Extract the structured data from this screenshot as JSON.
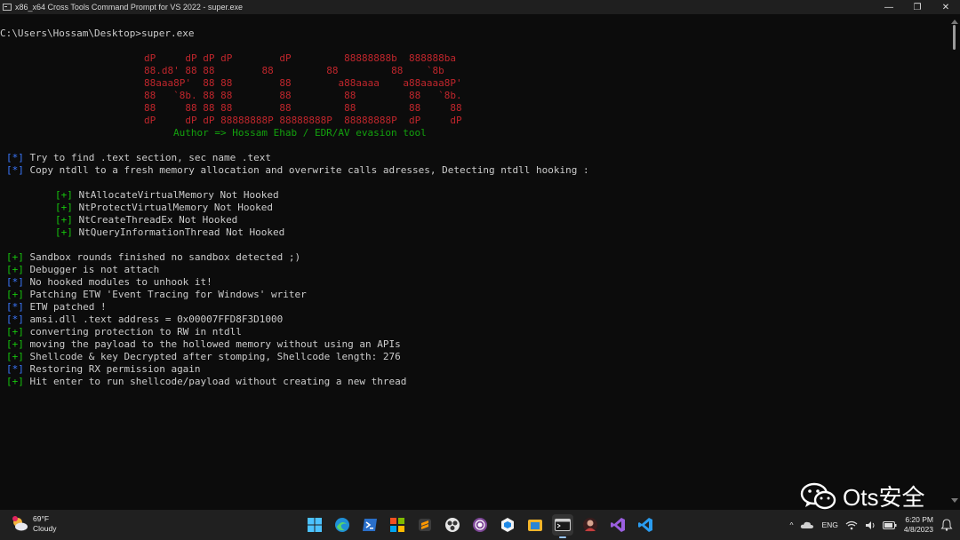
{
  "window": {
    "title": "x86_x64 Cross Tools Command Prompt for VS 2022 - super.exe",
    "minimize_glyph": "—",
    "maximize_glyph": "❐",
    "close_glyph": "✕"
  },
  "console": {
    "prompt": "C:\\Users\\Hossam\\Desktop>super.exe",
    "banner": [
      "dP     dP dP dP        dP         88888888b  888888ba",
      "88.d8' 88 88        88         88         88    `8b",
      "88aaa8P'  88 88        88        a88aaaa    a88aaaa8P'",
      "88   `8b. 88 88        88         88         88   `8b.",
      "88     88 88 88        88         88         88     88",
      "dP     dP dP 88888888P 88888888P  88888888P  dP     dP"
    ],
    "author": "Author => Hossam Ehab / EDR/AV evasion tool",
    "intro": [
      {
        "tag": "[*]",
        "kind": "info",
        "text": "Try to find .text section, sec name .text"
      },
      {
        "tag": "[*]",
        "kind": "info",
        "text": "Copy ntdll to a fresh memory allocation and overwrite calls adresses, Detecting ntdll hooking :"
      }
    ],
    "hooks": [
      {
        "tag": "[+]",
        "kind": "ok",
        "text": "NtAllocateVirtualMemory Not Hooked"
      },
      {
        "tag": "[+]",
        "kind": "ok",
        "text": "NtProtectVirtualMemory Not Hooked"
      },
      {
        "tag": "[+]",
        "kind": "ok",
        "text": "NtCreateThreadEx Not Hooked"
      },
      {
        "tag": "[+]",
        "kind": "ok",
        "text": "NtQueryInformationThread Not Hooked"
      }
    ],
    "log": [
      {
        "tag": "[+]",
        "kind": "ok",
        "text": "Sandbox rounds finished no sandbox detected ;)"
      },
      {
        "tag": "[+]",
        "kind": "ok",
        "text": "Debugger is not attach"
      },
      {
        "tag": "[*]",
        "kind": "info",
        "text": "No hooked modules to unhook it!"
      },
      {
        "tag": "[+]",
        "kind": "ok",
        "text": "Patching ETW 'Event Tracing for Windows' writer"
      },
      {
        "tag": "[*]",
        "kind": "info",
        "text": "ETW patched !"
      },
      {
        "tag": "[*]",
        "kind": "info",
        "text": "amsi.dll .text address = 0x00007FFD8F3D1000"
      },
      {
        "tag": "[+]",
        "kind": "ok",
        "text": "converting protection to RW in ntdll"
      },
      {
        "tag": "[+]",
        "kind": "ok",
        "text": "moving the payload to the hollowed memory without using an APIs"
      },
      {
        "tag": "[+]",
        "kind": "ok",
        "text": "Shellcode & key Decrypted after stomping, Shellcode length: 276"
      },
      {
        "tag": "[*]",
        "kind": "info",
        "text": "Restoring RX permission again"
      },
      {
        "tag": "[+]",
        "kind": "ok",
        "text": "Hit enter to run shellcode/payload without creating a new thread"
      }
    ]
  },
  "watermark": {
    "text": "Ots安全"
  },
  "taskbar": {
    "weather": {
      "temp": "69°F",
      "condition": "Cloudy"
    },
    "apps": [
      "windows-start",
      "edge",
      "powershell",
      "store",
      "sublime",
      "obs",
      "tor",
      "app-cube",
      "files",
      "terminal",
      "avatar-app",
      "visual-studio",
      "vscode"
    ],
    "tray": {
      "chevron": "^",
      "language": "ENG",
      "time": "6:20 PM",
      "date": "4/8/2023"
    }
  },
  "colors": {
    "banner": "#c0262c",
    "ok": "#16c60c",
    "info": "#3b78ff",
    "text": "#cccccc"
  }
}
